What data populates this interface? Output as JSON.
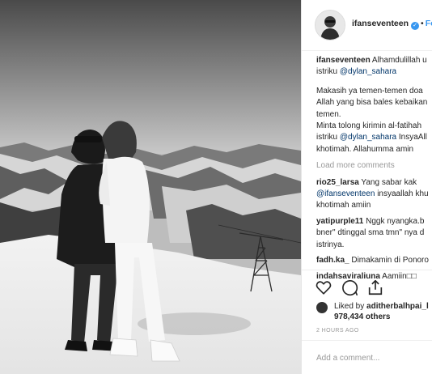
{
  "post": {
    "username": "ifanseventeen",
    "follow_label": "Fo",
    "separator": "•",
    "verified_mark": "✓"
  },
  "caption": {
    "username": "ifanseventeen",
    "lines": [
      " Alhamdulillah u",
      "istriku ",
      "@dylan_sahara",
      "Makasih ya temen-temen doa",
      "Allah yang bisa bales kebaikan",
      "temen.",
      "Minta tolong kirimin al-fatihah",
      "istriku ",
      "@dylan_sahara",
      " InsyaAll",
      "khotimah. Allahumma amin"
    ]
  },
  "load_more": "Load more comments",
  "comments": [
    {
      "user": "rio25_larsa",
      "lines": [
        " Yang sabar kak",
        "@ifanseventeen",
        " insyaallah khu",
        "khotimah amiin"
      ]
    },
    {
      "user": "yatipurple11",
      "lines": [
        " Nggk nyangka.b",
        "bner\" dtinggal sma tmn\" nya d",
        "istrinya."
      ]
    },
    {
      "user": "fadh.ka_",
      "lines": [
        " Dimakamin di Ponoro"
      ]
    },
    {
      "user": "indahsaviraliuna",
      "lines": [
        " Aamiin□□"
      ]
    }
  ],
  "icons": {
    "like": "heart-icon",
    "comment": "comment-icon",
    "share": "share-icon",
    "verified": "verified-badge-icon"
  },
  "likes": {
    "prefix": "Liked by ",
    "user": "aditherbalhpai_l",
    "count": "978,434 others"
  },
  "timestamp": "2 HOURS AGO",
  "add_comment_placeholder": "Add a comment..."
}
